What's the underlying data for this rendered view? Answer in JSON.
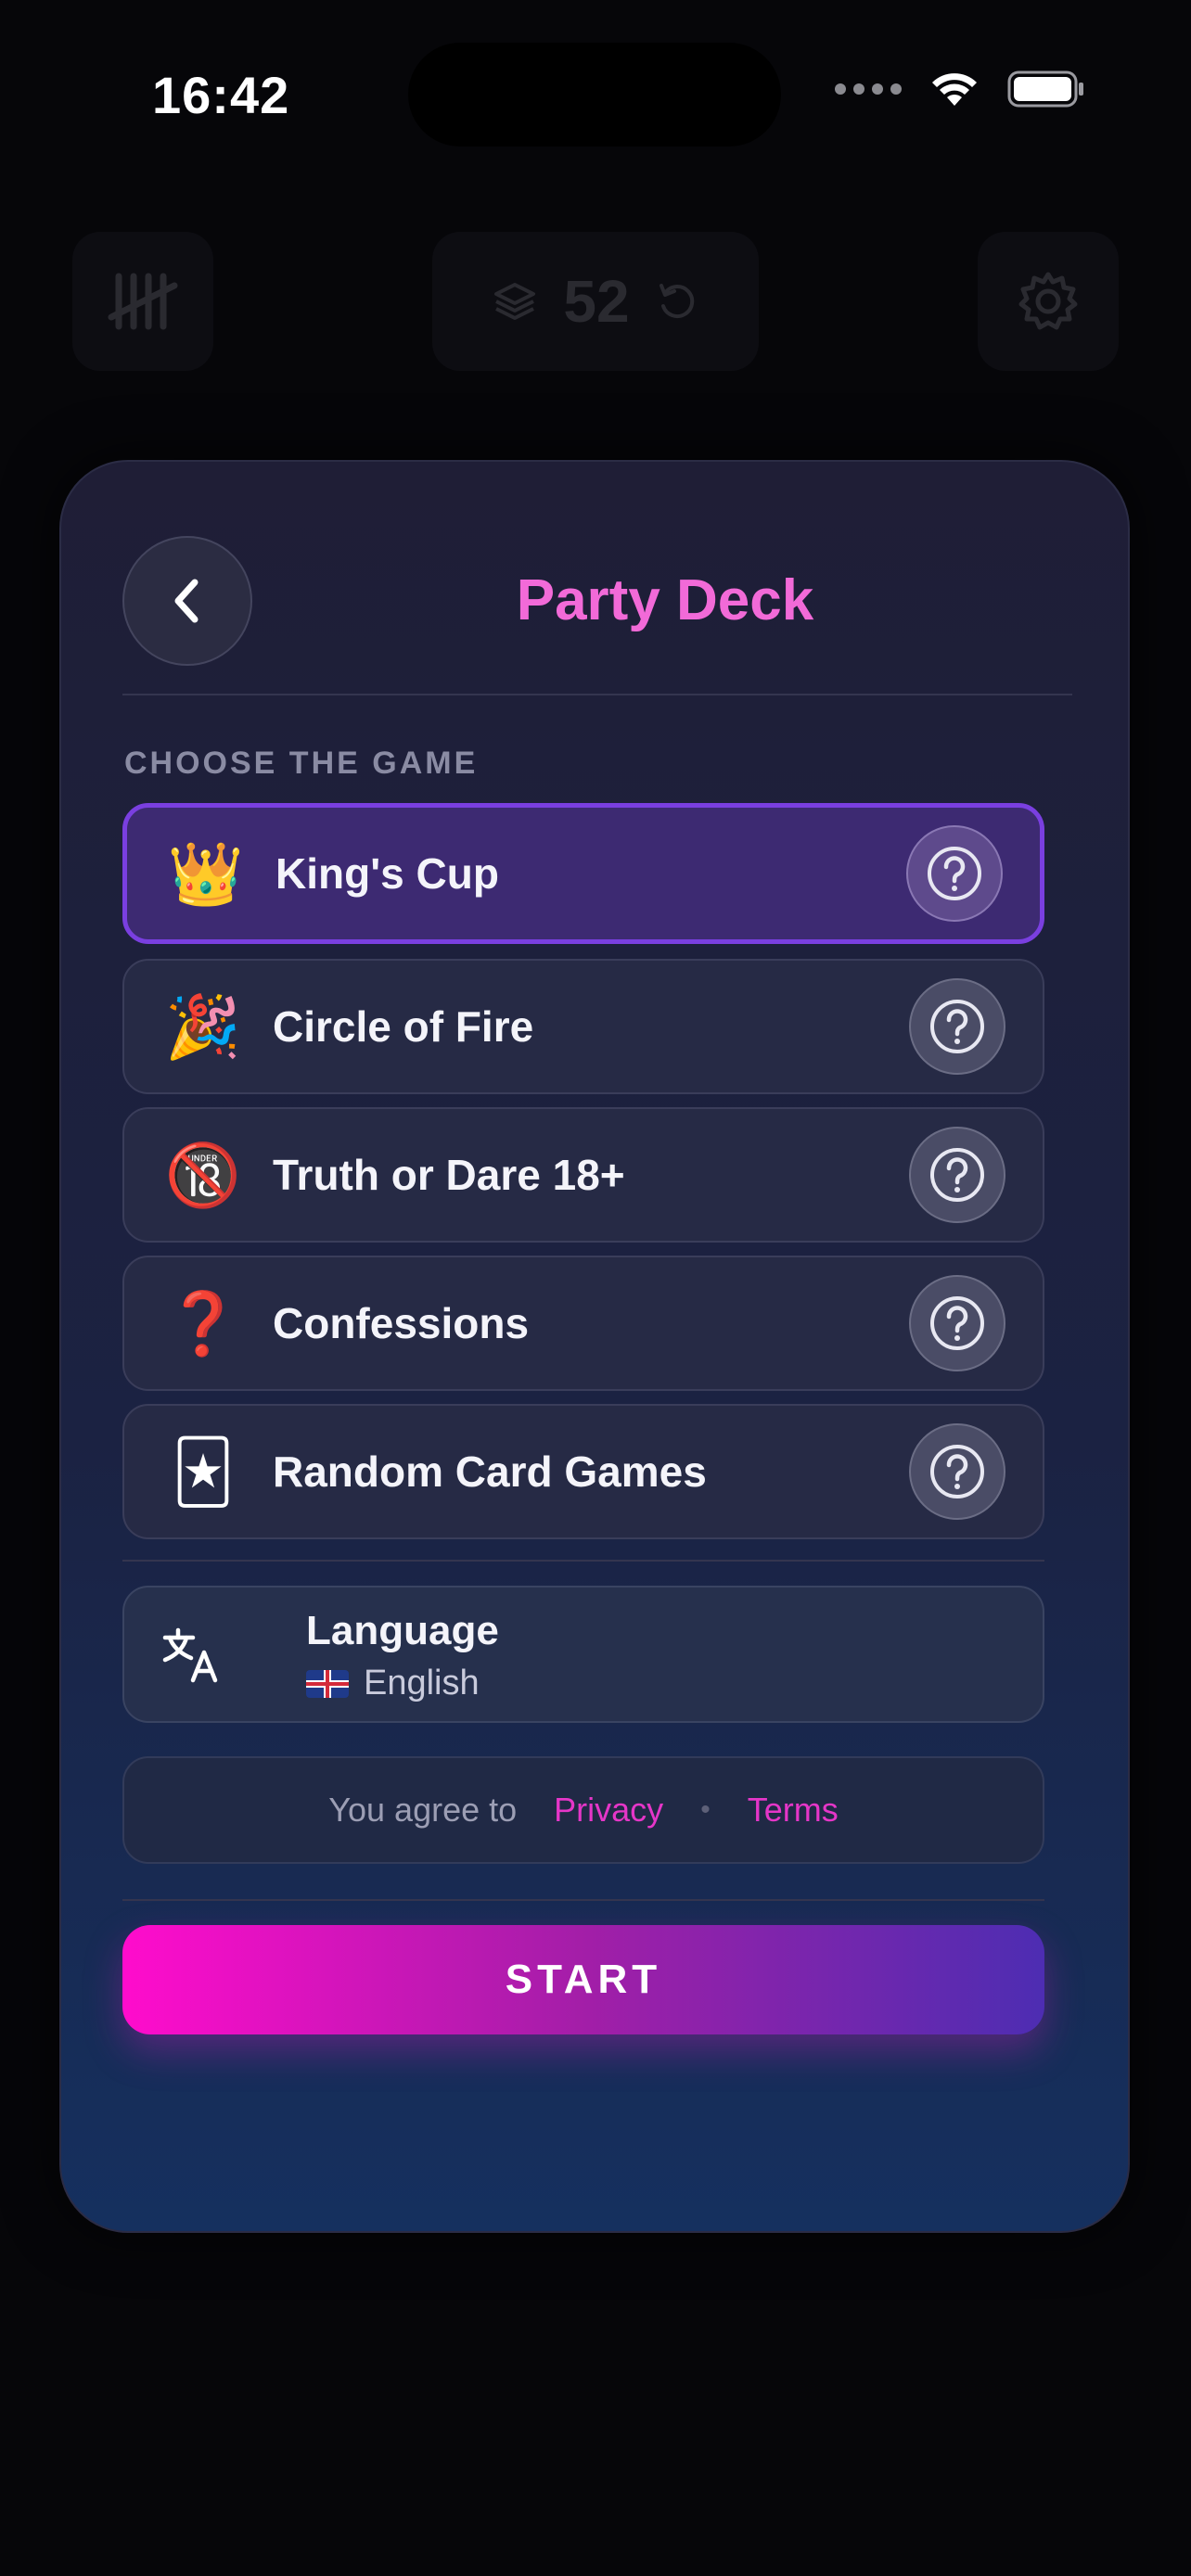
{
  "status_bar": {
    "time": "16:42"
  },
  "background_toolbar": {
    "card_count": "52"
  },
  "sheet": {
    "title": "Party Deck",
    "section_label": "CHOOSE THE GAME",
    "games": [
      {
        "emoji": "👑",
        "name": "King's Cup",
        "selected": true
      },
      {
        "emoji": "🎉",
        "name": "Circle of Fire",
        "selected": false
      },
      {
        "emoji": "🔞",
        "name": "Truth or Dare 18+",
        "selected": false
      },
      {
        "emoji": "❓",
        "name": "Confessions",
        "selected": false
      },
      {
        "emoji": "🃏",
        "name": "Random Card Games",
        "selected": false
      }
    ],
    "language": {
      "title": "Language",
      "value": "English"
    },
    "terms": {
      "prefix": "You agree to",
      "privacy": "Privacy",
      "separator": "•",
      "terms": "Terms"
    },
    "start_label": "START"
  },
  "colors": {
    "accent_pink": "#f26ad8",
    "selected_border": "#7a3fe0",
    "link": "#e536c8"
  }
}
